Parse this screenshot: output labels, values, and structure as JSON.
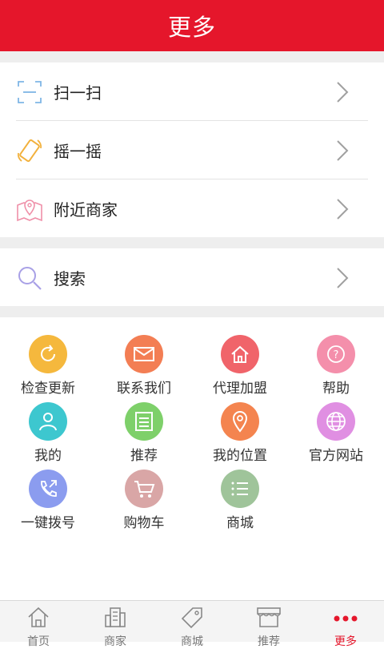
{
  "header": {
    "title": "更多"
  },
  "list1": [
    {
      "label": "扫一扫",
      "icon": "scan-icon"
    },
    {
      "label": "摇一摇",
      "icon": "shake-phone-icon"
    },
    {
      "label": "附近商家",
      "icon": "map-pin-icon"
    }
  ],
  "list2": [
    {
      "label": "搜索",
      "icon": "search-icon"
    }
  ],
  "grid": [
    {
      "label": "检查更新",
      "icon": "refresh-icon",
      "color": "#f5b83d"
    },
    {
      "label": "联系我们",
      "icon": "mail-icon",
      "color": "#f37e54"
    },
    {
      "label": "代理加盟",
      "icon": "home-icon",
      "color": "#f0646a"
    },
    {
      "label": "帮助",
      "icon": "help-icon",
      "color": "#f48fab"
    },
    {
      "label": "我的",
      "icon": "user-icon",
      "color": "#3dc7cf"
    },
    {
      "label": "推荐",
      "icon": "list-icon",
      "color": "#7ed06a"
    },
    {
      "label": "我的位置",
      "icon": "location-icon",
      "color": "#f4844f"
    },
    {
      "label": "官方网站",
      "icon": "globe-icon",
      "color": "#e08fe2"
    },
    {
      "label": "一键拨号",
      "icon": "phone-icon",
      "color": "#8b9cef"
    },
    {
      "label": "购物车",
      "icon": "cart-icon",
      "color": "#d9a6a6"
    },
    {
      "label": "商城",
      "icon": "store-list-icon",
      "color": "#9fc49a"
    }
  ],
  "tabs": [
    {
      "label": "首页",
      "icon": "house-icon"
    },
    {
      "label": "商家",
      "icon": "building-icon"
    },
    {
      "label": "商城",
      "icon": "tag-icon"
    },
    {
      "label": "推荐",
      "icon": "storefront-icon"
    },
    {
      "label": "更多",
      "icon": "more-dots-icon",
      "active": true
    }
  ],
  "colors": {
    "accent": "#e5162b",
    "background_gap": "#eeeeee"
  }
}
